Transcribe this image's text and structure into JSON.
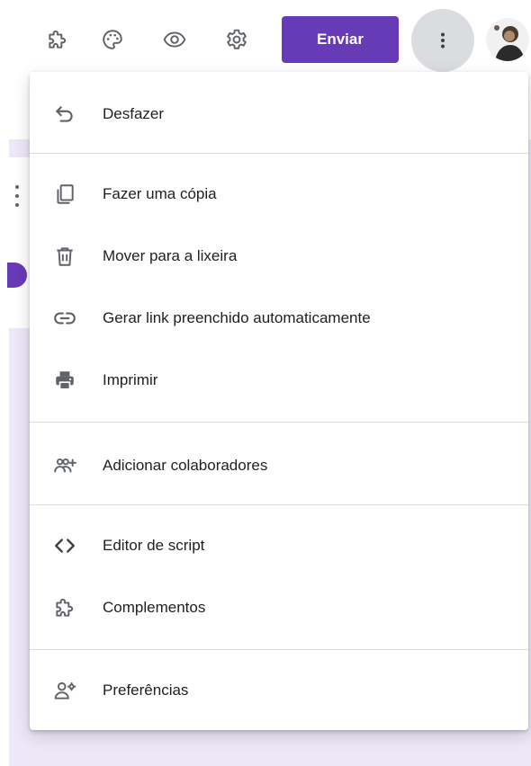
{
  "toolbar": {
    "icons": [
      "puzzle-icon",
      "palette-icon",
      "eye-icon",
      "gear-icon"
    ],
    "send_label": "Enviar",
    "more_icon": "vertical-dots-icon"
  },
  "colors": {
    "accent": "#673ab7",
    "page_background": "#ece8f8",
    "more_button_background": "#dadce0"
  },
  "menu": {
    "items": [
      {
        "label": "Desfazer",
        "icon": "undo-icon"
      },
      {
        "label": "Fazer uma cópia",
        "icon": "copy-icon"
      },
      {
        "label": "Mover para a lixeira",
        "icon": "trash-icon"
      },
      {
        "label": "Gerar link preenchido automaticamente",
        "icon": "link-icon"
      },
      {
        "label": "Imprimir",
        "icon": "printer-icon"
      },
      {
        "label": "Adicionar colaboradores",
        "icon": "add-people-icon"
      },
      {
        "label": "Editor de script",
        "icon": "code-icon"
      },
      {
        "label": "Complementos",
        "icon": "puzzle-icon"
      },
      {
        "label": "Preferências",
        "icon": "person-settings-icon"
      }
    ]
  }
}
